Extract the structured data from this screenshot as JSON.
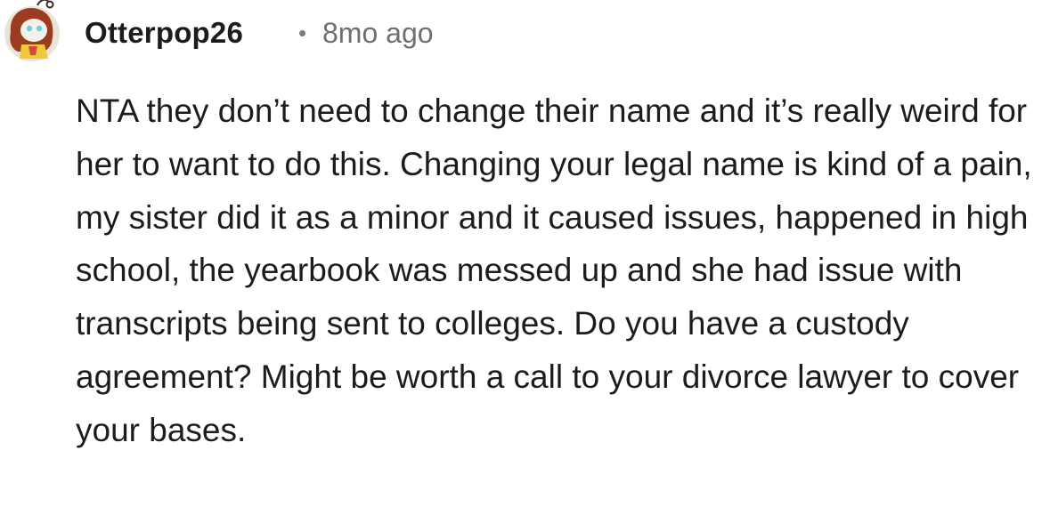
{
  "comment": {
    "author": "Otterpop26",
    "separator": "•",
    "timestamp": "8mo ago",
    "avatar_icon": "snoo-avatar-icon",
    "body": "NTA they don’t need to change their name and it’s really weird for her to want to do this. Changing your legal name is kind of a pain, my sister did it as a minor and it caused issues, happened in high school, the yearbook was messed up and she had issue with transcripts being sent to colleges. Do you have a custody agreement? Might be worth a call to your divorce lawyer to cover your bases."
  }
}
